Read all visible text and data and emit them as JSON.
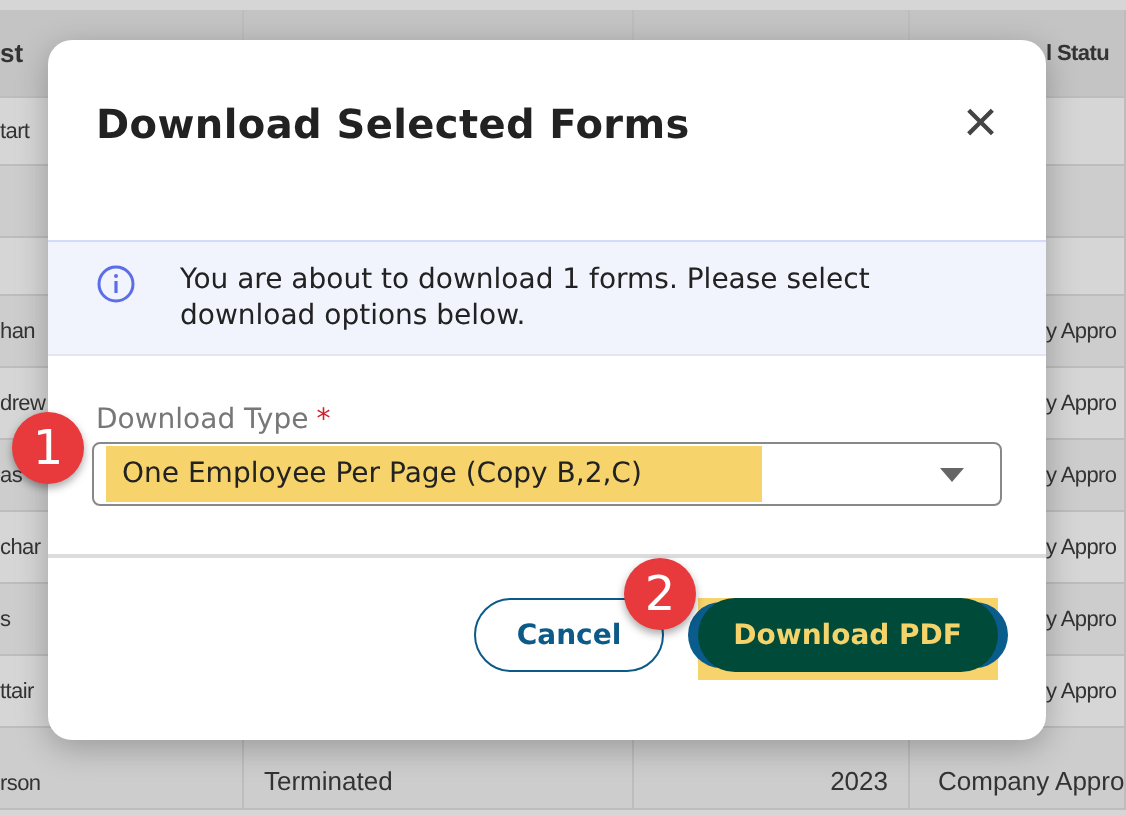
{
  "table": {
    "columns": [
      "st",
      "",
      "",
      "l Statu"
    ],
    "rows": [
      {
        "cells": [
          "tart",
          "",
          "",
          ""
        ]
      },
      {
        "cells": [
          "",
          "",
          "",
          ""
        ]
      },
      {
        "cells": [
          "",
          "",
          "",
          ""
        ]
      },
      {
        "cells": [
          "han",
          "",
          "",
          "y Appro"
        ]
      },
      {
        "cells": [
          "drew",
          "",
          "",
          "y Appro"
        ]
      },
      {
        "cells": [
          "as",
          "",
          "",
          "y Appro"
        ]
      },
      {
        "cells": [
          "char",
          "",
          "",
          "y Appro"
        ]
      },
      {
        "cells": [
          "s",
          "",
          "",
          "y Appro"
        ]
      },
      {
        "cells": [
          "ttair",
          "",
          "",
          "y Appro"
        ]
      },
      {
        "cells": [
          "rson",
          "Terminated",
          "2023",
          "Company Appro"
        ]
      }
    ]
  },
  "dialog": {
    "title": "Download Selected Forms",
    "close": "×",
    "info": "You are about to download 1 forms. Please select download options below.",
    "field": {
      "label": "Download Type",
      "required_mark": "*",
      "value": "One Employee Per Page (Copy B,2,C)",
      "highlighted": true
    },
    "buttons": [
      {
        "label": "Cancel",
        "kind": "secondary",
        "highlighted": false
      },
      {
        "label": "Download PDF",
        "kind": "primary",
        "highlighted": true
      }
    ]
  },
  "steps": [
    "1",
    "2"
  ]
}
